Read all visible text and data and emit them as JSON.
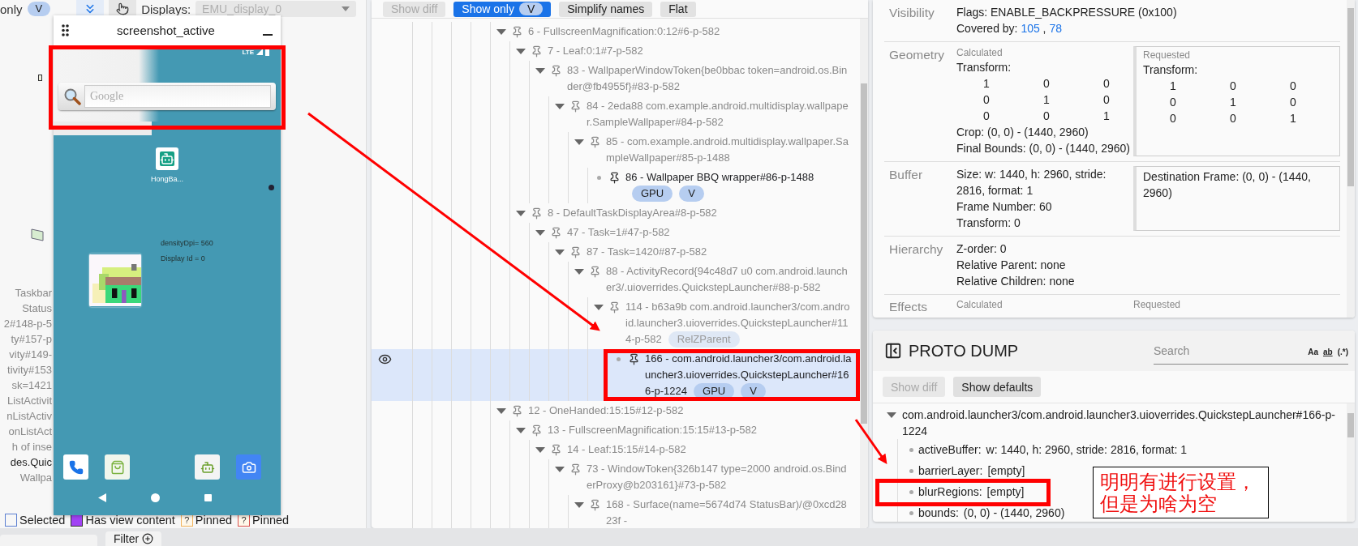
{
  "left_panel": {
    "toolbar": {
      "only_label": "only",
      "only_badge": "V",
      "displays_label": "Displays:",
      "display_value": "EMU_display_0"
    },
    "background_labels": [
      {
        "text": "Taskbar",
        "visible": false
      },
      {
        "text": "Status",
        "visible": false
      },
      {
        "text": "2#148-p-5",
        "visible": false
      },
      {
        "text": "ty#157-p",
        "visible": false
      },
      {
        "text": "vity#149-",
        "visible": false
      },
      {
        "text": "tivity#153",
        "visible": false
      },
      {
        "text": "sk=1421",
        "visible": false
      },
      {
        "text": "ListActivit",
        "visible": false
      },
      {
        "text": "nListActiv",
        "visible": false
      },
      {
        "text": "onListAct",
        "visible": false
      },
      {
        "text": "h of inse",
        "visible": false
      },
      {
        "text": "des.Quic",
        "visible": true
      },
      {
        "text": "Wallpa",
        "visible": false
      }
    ],
    "phone_window": {
      "title": "screenshot_active",
      "network": "LTE",
      "search_placeholder": "Google",
      "search_annotated": true,
      "app_label": "HongBa...",
      "info_lines": [
        "densityDpi= 560",
        "Display Id = 0"
      ]
    },
    "legend": [
      {
        "label": "Selected",
        "kind": "outline",
        "color": "#5b7fd1"
      },
      {
        "label": "Has view content",
        "kind": "fill",
        "color": "#a142f4"
      },
      {
        "label": "Pinned",
        "kind": "question",
        "mark": "?",
        "color": "#f2b35a"
      },
      {
        "label": "Pinned",
        "kind": "question",
        "mark": "?",
        "color": "#d9534f"
      }
    ],
    "bottom_tabs": [
      {
        "label": "Filter"
      }
    ]
  },
  "middle_panel": {
    "toolbar": [
      {
        "label": "Show diff",
        "disabled": true,
        "selected": false
      },
      {
        "label": "Show only",
        "badge": "V",
        "disabled": false,
        "selected": true
      },
      {
        "label": "Simplify names",
        "disabled": false,
        "selected": false
      },
      {
        "label": "Flat",
        "disabled": false,
        "selected": false
      }
    ],
    "tree": [
      {
        "label": "6 - FullscreenMagnification:0:12#6-p-582",
        "visible": false,
        "expanded": true,
        "selected": false,
        "children": [
          {
            "label": "7 - Leaf:0:1#7-p-582",
            "visible": false,
            "expanded": true,
            "selected": false,
            "children": [
              {
                "label": "83 - WallpaperWindowToken{be0bbac token=android.os.Binder@fb4955f}#83-p-582",
                "visible": false,
                "expanded": true,
                "selected": false,
                "children": [
                  {
                    "label": "84 - 2eda88 com.example.android.multidisplay.wallpaper.SampleWallpaper#84-p-582",
                    "visible": false,
                    "expanded": true,
                    "selected": false,
                    "children": [
                      {
                        "label": "85 - com.example.android.multidisplay.wallpaper.SampleWallpaper#85-p-1488",
                        "visible": false,
                        "expanded": true,
                        "selected": false,
                        "children": [
                          {
                            "label": "86 - Wallpaper BBQ wrapper#86-p-1488",
                            "visible": true,
                            "selected": false,
                            "chips": [
                              "GPU",
                              "V"
                            ]
                          }
                        ]
                      }
                    ]
                  }
                ]
              }
            ]
          },
          {
            "label": "8 - DefaultTaskDisplayArea#8-p-582",
            "visible": false,
            "expanded": true,
            "selected": false,
            "children": [
              {
                "label": "47 - Task=1#47-p-582",
                "visible": false,
                "expanded": true,
                "selected": false,
                "children": [
                  {
                    "label": "87 - Task=1420#87-p-582",
                    "visible": false,
                    "expanded": true,
                    "selected": false,
                    "children": [
                      {
                        "label": "88 - ActivityRecord{94c48d7 u0 com.android.launcher3/.uioverrides.QuickstepLauncher#88-p-582",
                        "visible": false,
                        "expanded": true,
                        "selected": false,
                        "children": [
                          {
                            "label": "114 - b63a9b com.android.launcher3/com.android.launcher3.uioverrides.QuickstepLauncher#114-p-582",
                            "visible": false,
                            "expanded": true,
                            "selected": false,
                            "chips": [
                              "RelZParent"
                            ],
                            "children": [
                              {
                                "label": "166 - com.android.launcher3/com.android.launcher3.uioverrides.QuickstepLauncher#166-p-1224",
                                "visible": true,
                                "selected": true,
                                "annotated": true,
                                "chips": [
                                  "GPU",
                                  "V"
                                ]
                              }
                            ]
                          }
                        ]
                      }
                    ]
                  }
                ]
              }
            ]
          }
        ]
      },
      {
        "label": "12 - OneHanded:15:15#12-p-582",
        "visible": false,
        "expanded": true,
        "selected": false,
        "children": [
          {
            "label": "13 - FullscreenMagnification:15:15#13-p-582",
            "visible": false,
            "expanded": true,
            "selected": false,
            "children": [
              {
                "label": "14 - Leaf:15:15#14-p-582",
                "visible": false,
                "expanded": true,
                "selected": false,
                "children": [
                  {
                    "label": "73 - WindowToken{326b147 type=2000 android.os.BinderProxy@b203161}#73-p-582",
                    "visible": false,
                    "expanded": true,
                    "selected": false,
                    "children": [
                      {
                        "label": "168 - Surface(name=5674d74 StatusBar)/@0xcd2823f -",
                        "visible": false,
                        "expanded": true,
                        "selected": false
                      }
                    ]
                  }
                ]
              }
            ]
          }
        ]
      }
    ]
  },
  "properties": {
    "visibility": {
      "label": "Visibility",
      "lines": [
        "Flags: ENABLE_BACKPRESSURE (0x100)"
      ],
      "covered_by_label": "Covered by:",
      "covered_by_separator": ",",
      "covered_by": [
        "105",
        "78"
      ]
    },
    "geometry": {
      "label": "Geometry",
      "calculated": {
        "heading": "Calculated",
        "transform_label": "Transform:",
        "matrix": [
          [
            "1",
            "0",
            "0"
          ],
          [
            "0",
            "1",
            "0"
          ],
          [
            "0",
            "0",
            "1"
          ]
        ],
        "lines": [
          "Crop: (0, 0) - (1440, 2960)",
          "Final Bounds: (0, 0) - (1440, 2960)"
        ]
      },
      "requested": {
        "heading": "Requested",
        "transform_label": "Transform:",
        "matrix": [
          [
            "1",
            "0",
            "0"
          ],
          [
            "0",
            "1",
            "0"
          ],
          [
            "0",
            "0",
            "1"
          ]
        ]
      }
    },
    "buffer": {
      "label": "Buffer",
      "lines": [
        "Size: w: 1440, h: 2960, stride: 2816, format: 1",
        "Frame Number: 60",
        "Transform: 0"
      ],
      "requested_lines": [
        "Destination Frame: (0, 0) - (1440, 2960)"
      ]
    },
    "hierarchy": {
      "label": "Hierarchy",
      "lines": [
        "Z-order: 0",
        "Relative Parent: none",
        "Relative Children: none"
      ]
    },
    "effects": {
      "label": "Effects",
      "calculated_heading": "Calculated",
      "requested_heading": "Requested"
    }
  },
  "proto_dump": {
    "title": "PROTO DUMP",
    "search_placeholder": "Search",
    "search_options": [
      "Aa",
      "ab",
      "(.*)"
    ],
    "buttons": [
      {
        "label": "Show diff",
        "disabled": true
      },
      {
        "label": "Show defaults",
        "disabled": false
      }
    ],
    "root": {
      "label": "com.android.launcher3/com.android.launcher3.uioverrides.QuickstepLauncher#166-p-1224",
      "expanded": true,
      "fields": [
        {
          "key": "activeBuffer:",
          "value": "w: 1440, h: 2960, stride: 2816, format: 1",
          "annotated": false
        },
        {
          "key": "barrierLayer:",
          "value": "[empty]",
          "annotated": false
        },
        {
          "key": "blurRegions:",
          "value": "[empty]",
          "annotated": true
        },
        {
          "key": "bounds:",
          "value": "(0, 0) - (1440, 2960)",
          "annotated": false
        }
      ]
    }
  },
  "annotation": {
    "note": "明明有进行设置，但是为啥为空"
  }
}
